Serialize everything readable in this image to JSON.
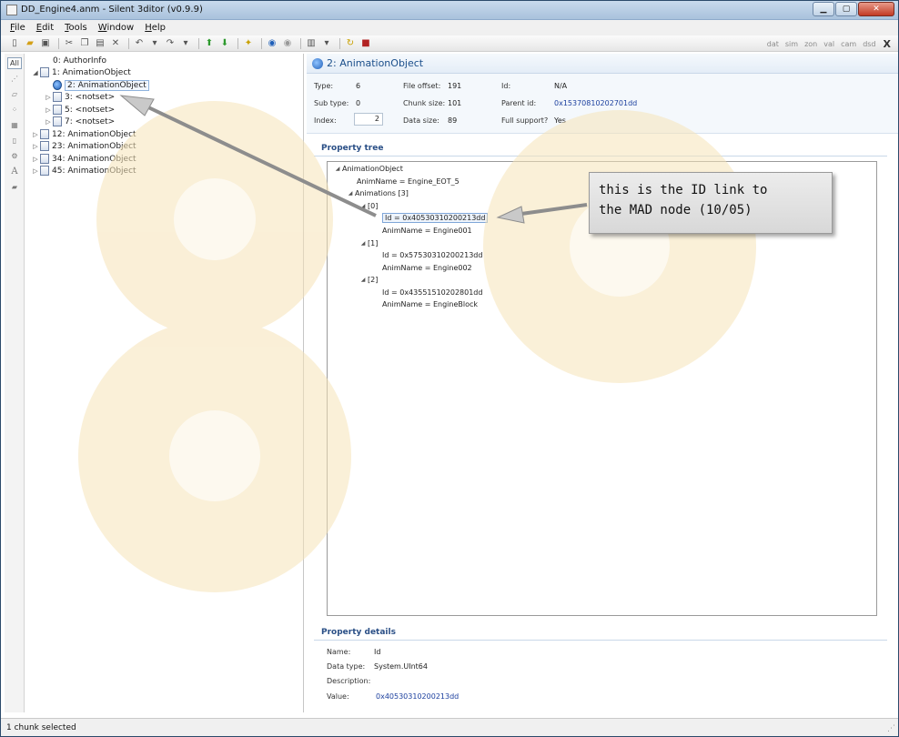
{
  "window": {
    "title": "DD_Engine4.anm - Silent 3ditor (v0.9.9)"
  },
  "menu": [
    {
      "label": "File",
      "accel": "F",
      "rest": "ile"
    },
    {
      "label": "Edit",
      "accel": "E",
      "rest": "dit"
    },
    {
      "label": "Tools",
      "accel": "T",
      "rest": "ools"
    },
    {
      "label": "Window",
      "accel": "W",
      "rest": "indow"
    },
    {
      "label": "Help",
      "accel": "H",
      "rest": "elp"
    }
  ],
  "toolbar": {
    "right_tags": [
      "dat",
      "sim",
      "zon",
      "val",
      "cam",
      "dsd"
    ],
    "close": "X"
  },
  "left_strip": {
    "all_label": "All",
    "buttons": [
      "layers-icon",
      "page-icon",
      "grid-icon",
      "image-icon",
      "document-icon",
      "gear-icon",
      "font-icon",
      "eraser-icon"
    ]
  },
  "tree": [
    {
      "label": "0: AuthorInfo",
      "arrow": "",
      "depth": 1
    },
    {
      "label": "1: AnimationObject",
      "arrow": "◢",
      "depth": 0
    },
    {
      "label": "2: AnimationObject",
      "arrow": "",
      "depth": 1,
      "selected": true
    },
    {
      "label": "3: <notset>",
      "arrow": "▷",
      "depth": 1
    },
    {
      "label": "5: <notset>",
      "arrow": "▷",
      "depth": 1
    },
    {
      "label": "7: <notset>",
      "arrow": "▷",
      "depth": 1
    },
    {
      "label": "12: AnimationObject",
      "arrow": "▷",
      "depth": 0
    },
    {
      "label": "23: AnimationObject",
      "arrow": "▷",
      "depth": 0
    },
    {
      "label": "34: AnimationObject",
      "arrow": "▷",
      "depth": 0
    },
    {
      "label": "45: AnimationObject",
      "arrow": "▷",
      "depth": 0
    }
  ],
  "header": {
    "title": "2: AnimationObject"
  },
  "info": {
    "type_label": "Type:",
    "type_value": "6",
    "subtype_label": "Sub type:",
    "subtype_value": "0",
    "index_label": "Index:",
    "index_value": "2",
    "fileoffset_label": "File offset:",
    "fileoffset_value": "191",
    "chunksize_label": "Chunk size:",
    "chunksize_value": "101",
    "datasize_label": "Data size:",
    "datasize_value": "89",
    "id_label": "Id:",
    "id_value": "N/A",
    "parentid_label": "Parent id:",
    "parentid_value": "0x15370810202701dd",
    "fullsupport_label": "Full support?",
    "fullsupport_value": "Yes"
  },
  "property_tree": {
    "title": "Property tree",
    "rows": [
      {
        "text": "AnimationObject",
        "arrow": "◢",
        "depth": 0
      },
      {
        "text": "AnimName = Engine_EOT_5",
        "arrow": "",
        "depth": 1
      },
      {
        "text": "Animations [3]",
        "arrow": "◢",
        "depth": 1
      },
      {
        "text": "[0]",
        "arrow": "◢",
        "depth": 2
      },
      {
        "text": "Id = 0x40530310200213dd",
        "arrow": "",
        "depth": 3,
        "selected": true
      },
      {
        "text": "AnimName = Engine001",
        "arrow": "",
        "depth": 3
      },
      {
        "text": "[1]",
        "arrow": "◢",
        "depth": 2
      },
      {
        "text": "Id = 0x57530310200213dd",
        "arrow": "",
        "depth": 3
      },
      {
        "text": "AnimName = Engine002",
        "arrow": "",
        "depth": 3
      },
      {
        "text": "[2]",
        "arrow": "◢",
        "depth": 2
      },
      {
        "text": "Id = 0x43551510202801dd",
        "arrow": "",
        "depth": 3
      },
      {
        "text": "AnimName = EngineBlock",
        "arrow": "",
        "depth": 3
      }
    ]
  },
  "property_details": {
    "title": "Property details",
    "name_label": "Name:",
    "name_value": "Id",
    "datatype_label": "Data type:",
    "datatype_value": "System.UInt64",
    "description_label": "Description:",
    "description_value": "",
    "value_label": "Value:",
    "value_value": "0x40530310200213dd"
  },
  "callout": {
    "line1": "this is the ID link to",
    "line2": "the MAD node (10/05)"
  },
  "status": {
    "text": "1 chunk selected"
  }
}
